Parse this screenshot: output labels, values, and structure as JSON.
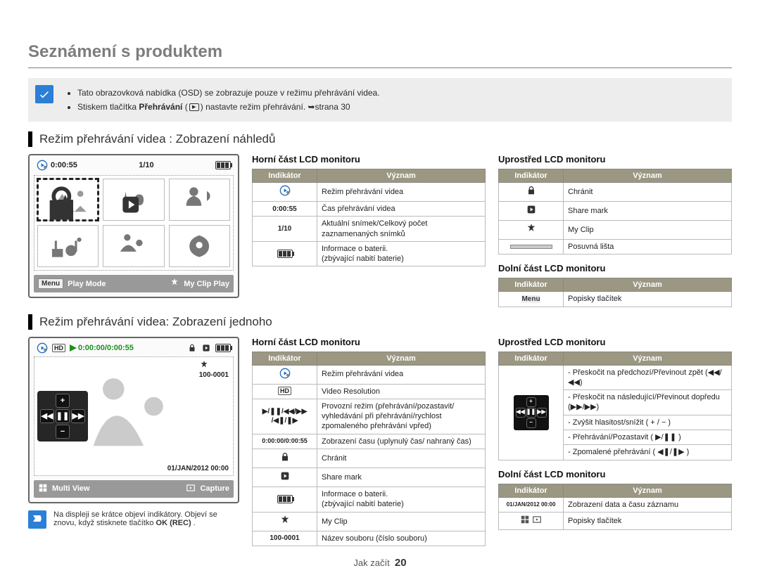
{
  "pageTitle": "Seznámení s produktem",
  "tip": {
    "bullet1": "Tato obrazovková nabídka (OSD) se zobrazuje pouze v režimu přehrávání videa.",
    "bullet2_pre": "Stiskem tlačítka ",
    "bullet2_bold": "Přehrávání",
    "bullet2_post1": " (",
    "bullet2_post2": ") nastavte režim přehrávání. ➥strana 30"
  },
  "sec1": {
    "header": "Režim přehrávání videa : Zobrazení náhledů",
    "lcd": {
      "time": "0:00:55",
      "counter": "1/10",
      "bottom": {
        "menuChip": "Menu",
        "playMode": "Play Mode",
        "myClipPlay": "My Clip Play"
      }
    },
    "top": {
      "title": "Horní část LCD monitoru",
      "col1": "Indikátor",
      "col2": "Význam",
      "r1": "Režim přehrávání videa",
      "r2_ind": "0:00:55",
      "r2": "Čas přehrávání videa",
      "r3_ind": "1/10",
      "r3": "Aktuální snímek/Celkový počet zaznamenaných snímků",
      "r4": "Informace o baterii.\n(zbývající nabití baterie)"
    },
    "mid": {
      "title": "Uprostřed LCD monitoru",
      "col1": "Indikátor",
      "col2": "Význam",
      "r1": "Chránit",
      "r2": "Share mark",
      "r3": "My Clip",
      "r4": "Posuvná lišta"
    },
    "bot": {
      "title": "Dolní část LCD monitoru",
      "col1": "Indikátor",
      "col2": "Význam",
      "r1_ind": "Menu",
      "r1": "Popisky tlačítek"
    }
  },
  "sec2": {
    "header": "Režim přehrávání videa: Zobrazení jednoho",
    "lcd": {
      "elapsed": "0:00:00/0:00:55",
      "file": "100-0001",
      "datetime": "01/JAN/2012 00:00",
      "bottom": {
        "multiView": "Multi View",
        "capture": "Capture"
      },
      "hd": "HD"
    },
    "top": {
      "title": "Horní část LCD monitoru",
      "col1": "Indikátor",
      "col2": "Význam",
      "r1": "Režim přehrávání videa",
      "r2_ind": "HD",
      "r2": "Video Resolution",
      "r3": "Provozní režim (přehrávání/pozastavit/ vyhledávání při přehrávání/rychlost zpomaleného přehrávání vpřed)",
      "r4_ind": "0:00:00/0:00:55",
      "r4": "Zobrazení času (uplynulý čas/ nahraný čas)",
      "r5": "Chránit",
      "r6": "Share mark",
      "r7": "Informace o baterii.\n(zbývající nabití baterie)",
      "r8": "My Clip",
      "r9_ind": "100-0001",
      "r9": "Název souboru (číslo souboru)"
    },
    "mid": {
      "title": "Uprostřed LCD monitoru",
      "col1": "Indikátor",
      "col2": "Význam",
      "r1": "- Přeskočit na předchozí/Převinout zpět (◀◀/◀◀)",
      "r2": "- Přeskočit na následující/Převinout dopředu (▶▶/▶▶)",
      "r3": "- Zvýšit hlasitost/snížit ( + / − )",
      "r4": "- Přehrávání/Pozastavit ( ▶/❚❚ )",
      "r5": "- Zpomalené přehrávání ( ◀❚/❚▶ )"
    },
    "bot": {
      "title": "Dolní část LCD monitoru",
      "col1": "Indikátor",
      "col2": "Význam",
      "r1_ind": "01/JAN/2012 00:00",
      "r1": "Zobrazení data a času záznamu",
      "r2": "Popisky tlačítek"
    }
  },
  "note": {
    "text_pre": "Na displeji se krátce objeví indikátory. Objeví se znovu, když stisknete tlačítko ",
    "text_bold": "OK (REC)",
    "text_post": " ."
  },
  "footer": {
    "label": "Jak začít",
    "page": "20"
  }
}
